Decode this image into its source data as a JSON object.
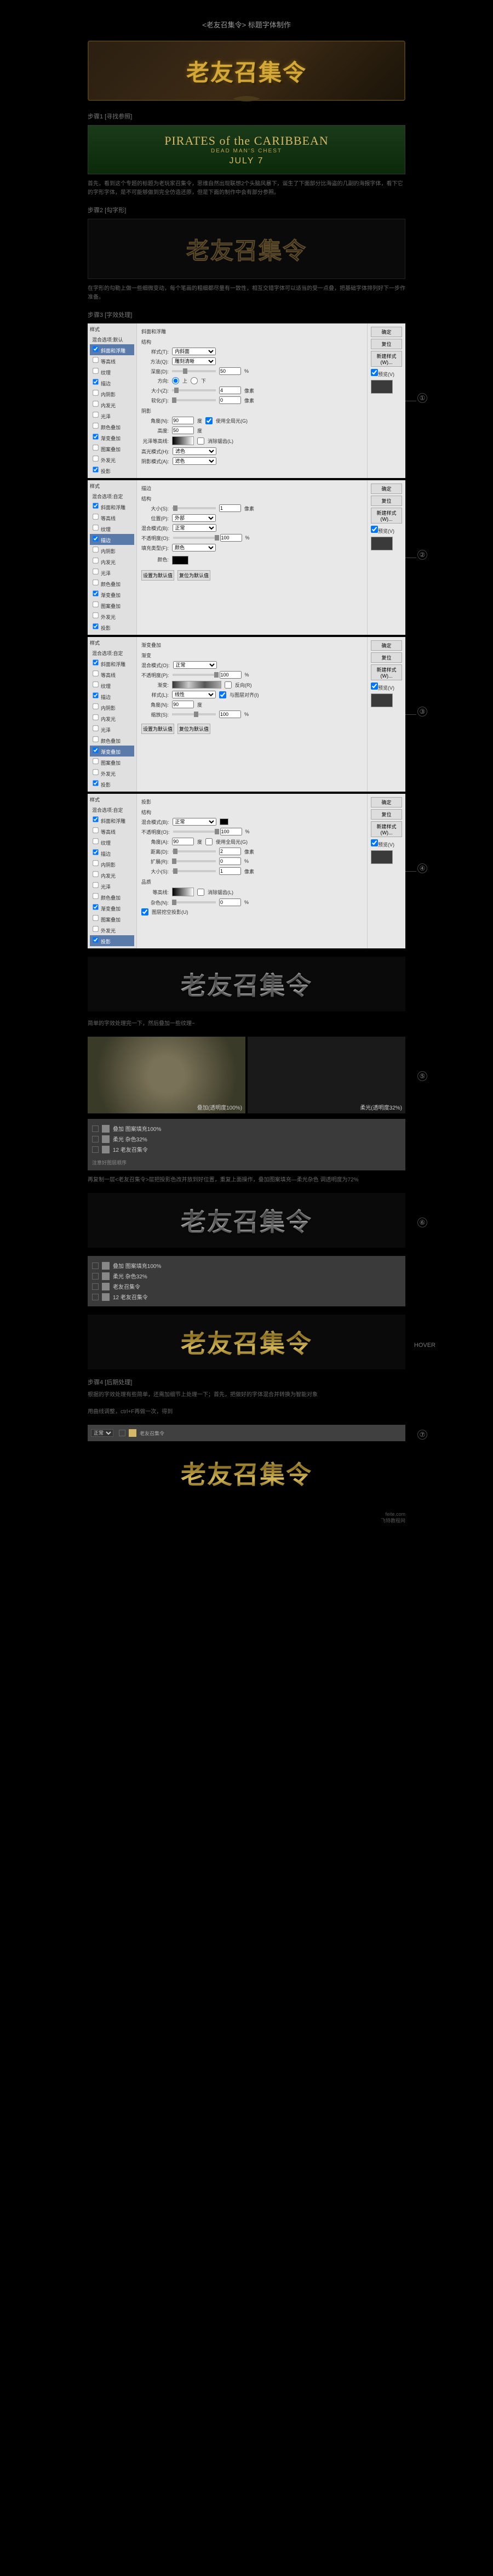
{
  "page_title": "<老友召集令> 标题字体制作",
  "logo_text": "老友召集令",
  "step1": {
    "label": "步骤1 [寻找参照]",
    "movie_title": "PIRATES of the CARIBBEAN",
    "movie_sub": "DEAD MAN'S CHEST",
    "movie_date": "JULY 7",
    "desc": "首先，看到这个专题的标题为老玩家召集令，思维自然出现联想2个头脑风暴下，诞生了下面部分比海盗的几副的海报字体，看下它的字形字体，是不可能够做到完全仿造还原，但是下面的制作中会有部分参照。"
  },
  "step2": {
    "label": "步骤2 [勾字形]",
    "desc": "在字形的勾勒上做一些细微变动，每个笔画的粗细都尽量有一致性，相互交错字体可以适当的受一点叠，把基础字体排列好下一步作准备。"
  },
  "step3": {
    "label": "步骤3 [字效处理]",
    "panels": {
      "sidebar_head": "混合选项:自定",
      "styles": [
        "混合选项:默认",
        "斜面和浮雕",
        "等高线",
        "纹理",
        "描边",
        "内阴影",
        "内发光",
        "光泽",
        "颜色叠加",
        "渐变叠加",
        "图案叠加",
        "外发光",
        "投影"
      ],
      "buttons": {
        "ok": "确定",
        "cancel": "复位",
        "new": "新建样式(W)...",
        "preview": "预览(V)"
      },
      "p1": {
        "title": "斜面和浮雕",
        "section": "结构",
        "style_label": "样式(T):",
        "style_val": "内斜面",
        "method_label": "方法(Q):",
        "method_val": "雕刻清晰",
        "depth_label": "深度(D):",
        "depth_val": "50",
        "direction_label": "方向:",
        "up": "上",
        "down": "下",
        "size_label": "大小(Z):",
        "size_val": "4",
        "soften_label": "软化(F):",
        "soften_val": "0",
        "shadow_section": "阴影",
        "angle_label": "角度(N):",
        "angle_val": "90",
        "global_light": "使用全局光(G)",
        "altitude_label": "高度:",
        "altitude_val": "50",
        "gloss_label": "光泽等高线:",
        "anti_alias": "消除锯齿(L)",
        "highlight_label": "高光模式(H):",
        "highlight_val": "滤色",
        "shadow_label": "阴影模式(A):",
        "shadow_val": "滤色"
      },
      "p2": {
        "title": "描边",
        "section": "结构",
        "size_label": "大小(S):",
        "size_val": "1",
        "pos_label": "位置(P):",
        "pos_val": "外部",
        "blend_label": "混合模式(B):",
        "blend_val": "正常",
        "opacity_label": "不透明度(O):",
        "opacity_val": "100",
        "fill_label": "填充类型(F):",
        "fill_val": "颜色",
        "color_label": "颜色:",
        "default_btn": "设置为默认值",
        "reset_btn": "复位为默认值"
      },
      "p3": {
        "title": "渐变叠加",
        "section": "渐变",
        "blend_label": "混合模式(O):",
        "blend_val": "正常",
        "opacity_label": "不透明度(P):",
        "opacity_val": "100",
        "gradient_label": "渐变:",
        "reverse": "反向(R)",
        "style_label": "样式(L):",
        "style_val": "线性",
        "align": "与图层对齐(I)",
        "angle_label": "角度(N):",
        "angle_val": "90",
        "scale_label": "缩放(S):",
        "scale_val": "100",
        "default_btn": "设置为默认值",
        "reset_btn": "复位为默认值"
      },
      "p4": {
        "title": "投影",
        "section": "结构",
        "blend_label": "混合模式(B):",
        "blend_val": "正常",
        "opacity_label": "不透明度(O):",
        "opacity_val": "100",
        "angle_label": "角度(A):",
        "angle_val": "90",
        "global_light": "使用全局光(G)",
        "distance_label": "距离(D):",
        "distance_val": "2",
        "spread_label": "扩展(R):",
        "spread_val": "0",
        "size_label": "大小(S):",
        "size_val": "1",
        "quality_section": "品质",
        "contour_label": "等高线:",
        "anti_alias": "消除锯齿(L)",
        "noise_label": "杂色(N):",
        "noise_val": "0",
        "knockout": "图层挖空投影(U)"
      }
    },
    "desc2": "简单的字效处理完一下，然后叠加一些纹理~",
    "texture1": "叠加(透明度100%)",
    "texture2": "柔光(透明度32%)",
    "layers": {
      "l1": "叠加 图案填充100%",
      "l2": "柔光 杂色32%",
      "l3": "12 老友召集令",
      "note": "注意好图层顺序"
    },
    "desc3": "再复制一层<老友召集令>层把投影色改并放到好位置，重复上面操作，叠加图案填充—柔光杂色 调透明度为72%",
    "layers2": {
      "l1": "叠加 图案填充100%",
      "l2": "柔光 杂色32%",
      "l3": "老友召集令",
      "l4": "12 老友召集令"
    },
    "hover": "HOVER"
  },
  "step4": {
    "label": "步骤4 [后期处理]",
    "desc": "根据的字效处理有些简单，还需加细节上处理一下；首先，把做好的字体混合并转换为智能对象",
    "desc2": "用曲线调整，ctrl+F再做一次，得到",
    "panel_label": "正常",
    "panel_layer": "老友召集令"
  },
  "watermark": {
    "line1": "feite.com",
    "line2": "飞特教程网"
  },
  "markers": [
    "①",
    "②",
    "③",
    "④",
    "⑤",
    "⑥",
    "⑦"
  ]
}
